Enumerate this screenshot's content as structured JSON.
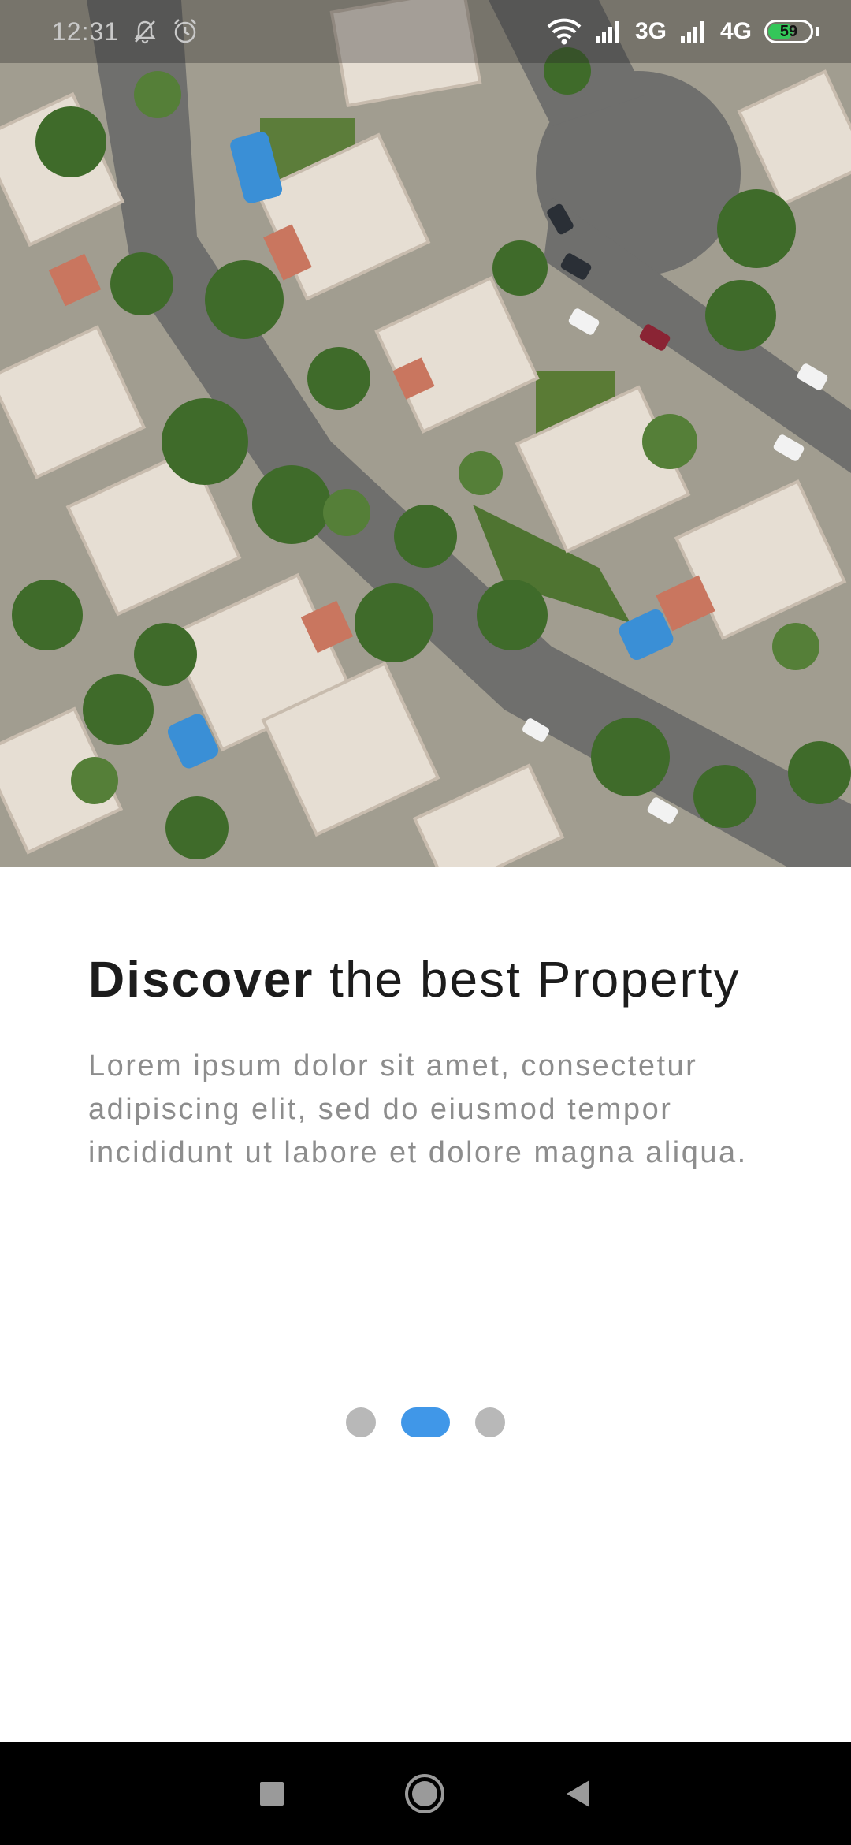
{
  "status_bar": {
    "time": "12:31",
    "network_1": "3G",
    "network_2": "4G",
    "battery_level": "59",
    "battery_fraction": 0.59,
    "icons": [
      "mute-bell-icon",
      "alarm-icon",
      "wifi-icon",
      "signal-icon",
      "signal-icon",
      "battery-icon"
    ]
  },
  "hero": {
    "image": "aerial-neighborhood-photo"
  },
  "onboarding": {
    "title_strong": "Discover",
    "title_rest": "the best Property",
    "description": "Lorem ipsum dolor sit amet, consectetur adipiscing elit, sed do eiusmod tempor incididunt ut labore et dolore magna aliqua."
  },
  "pager": {
    "count": 3,
    "active_index": 1,
    "active_color": "#4097E8",
    "inactive_color": "#B8B8B8"
  },
  "nav_bar": {
    "buttons": [
      "recents-square-icon",
      "home-circle-icon",
      "back-triangle-icon"
    ]
  }
}
